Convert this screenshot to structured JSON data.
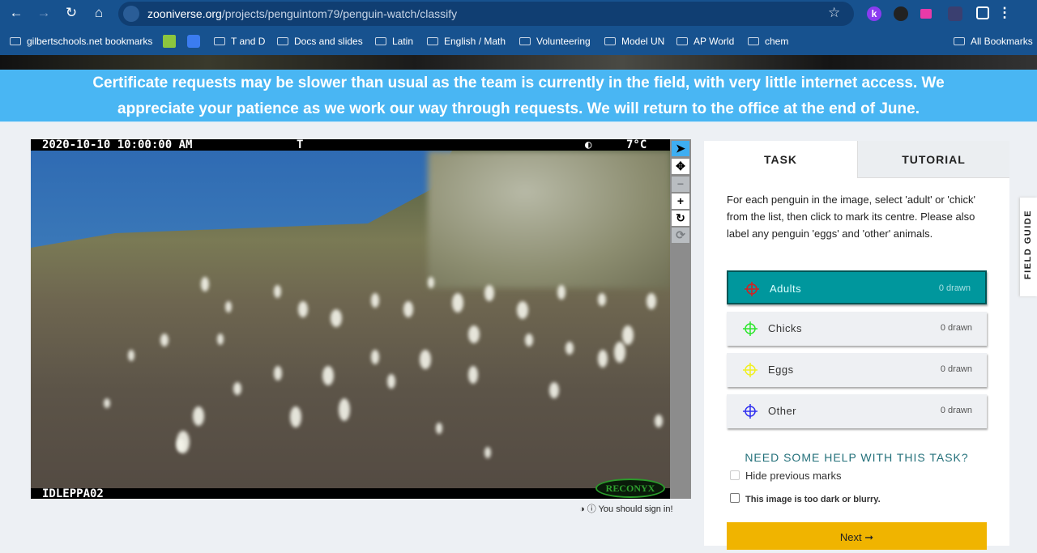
{
  "browser": {
    "url_domain": "zooniverse.org",
    "url_path": "/projects/penguintom79/penguin-watch/classify",
    "bookmarks": [
      "gilbertschools.net bookmarks",
      "T and D",
      "Docs and slides",
      "Latin",
      "English / Math",
      "Volunteering",
      "Model UN",
      "AP World",
      "chem"
    ],
    "all_bookmarks": "All Bookmarks"
  },
  "banner": {
    "line1": "Certificate requests may be slower than usual as the team is currently in the field, with very little internet access. We",
    "line2": "appreciate your patience as we work our way through requests. We will return to the office at the end of June."
  },
  "camera": {
    "timestamp": "2020-10-10 10:00:00 AM",
    "flag": "T",
    "temperature": "7°C",
    "camera_id": "IDLEPPA02",
    "brand": "RECONYX"
  },
  "below_image": {
    "sign_in": "You should sign in!"
  },
  "panel": {
    "tabs": [
      "TASK",
      "TUTORIAL"
    ],
    "instructions": "For each penguin in the image, select 'adult' or 'chick' from the list, then click to mark its centre. Please also label any penguin 'eggs' and 'other' animals.",
    "choices": [
      {
        "label": "Adults",
        "count": "0 drawn",
        "color": "#d62020"
      },
      {
        "label": "Chicks",
        "count": "0 drawn",
        "color": "#2ee62e"
      },
      {
        "label": "Eggs",
        "count": "0 drawn",
        "color": "#f0f020"
      },
      {
        "label": "Other",
        "count": "0 drawn",
        "color": "#3030f0"
      }
    ],
    "help": "NEED SOME HELP WITH THIS TASK?",
    "hide_marks": "Hide previous marks",
    "too_dark": "This image is too dark or blurry.",
    "next": "Next ➞"
  },
  "field_guide": "FIELD GUIDE"
}
